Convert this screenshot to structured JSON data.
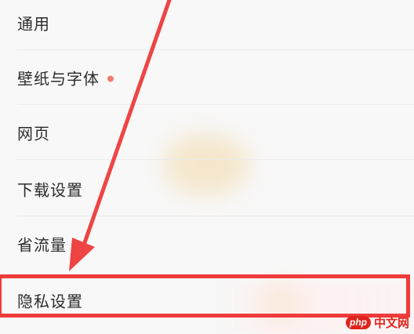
{
  "settings": {
    "items": [
      {
        "label": "通用",
        "has_dot": false
      },
      {
        "label": "壁纸与字体",
        "has_dot": true
      },
      {
        "label": "网页",
        "has_dot": false
      },
      {
        "label": "下载设置",
        "has_dot": false
      },
      {
        "label": "省流量",
        "has_dot": false
      },
      {
        "label": "隐私设置",
        "has_dot": false
      }
    ],
    "highlighted_item": "隐私设置"
  },
  "annotation": {
    "arrow_color": "#ef4444",
    "box_color": "#ef3b3b",
    "dot_color": "#f07d6e"
  },
  "watermark": {
    "badge": "php",
    "text": "中文网"
  }
}
